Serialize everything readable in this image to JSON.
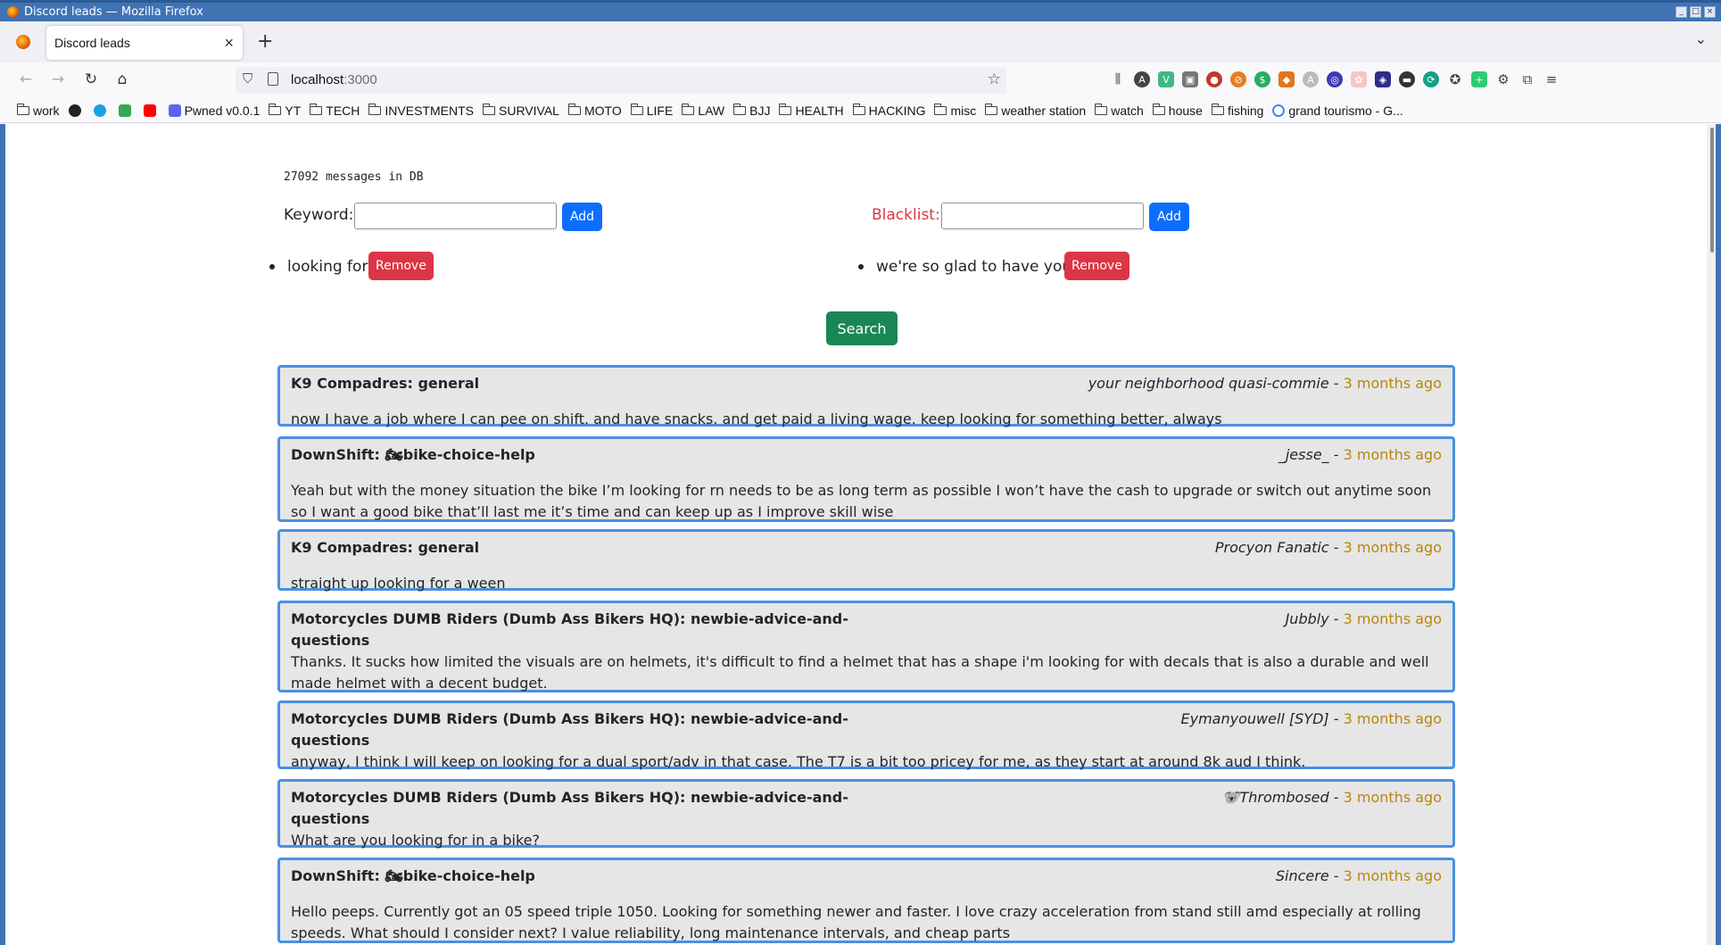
{
  "window": {
    "title": "Discord leads — Mozilla Firefox"
  },
  "tab": {
    "title": "Discord leads"
  },
  "url": {
    "host": "localhost",
    "port": ":3000"
  },
  "bookmarks": [
    {
      "label": "work",
      "kind": "folder"
    },
    {
      "label": "",
      "kind": "github"
    },
    {
      "label": "",
      "kind": "e"
    },
    {
      "label": "",
      "kind": "play"
    },
    {
      "label": "",
      "kind": "youtube"
    },
    {
      "label": "Pwned v0.0.1",
      "kind": "pwned"
    },
    {
      "label": "YT",
      "kind": "folder"
    },
    {
      "label": "TECH",
      "kind": "folder"
    },
    {
      "label": "INVESTMENTS",
      "kind": "folder"
    },
    {
      "label": "SURVIVAL",
      "kind": "folder"
    },
    {
      "label": "MOTO",
      "kind": "folder"
    },
    {
      "label": "LIFE",
      "kind": "folder"
    },
    {
      "label": "LAW",
      "kind": "folder"
    },
    {
      "label": "BJJ",
      "kind": "folder"
    },
    {
      "label": "HEALTH",
      "kind": "folder"
    },
    {
      "label": "HACKING",
      "kind": "folder"
    },
    {
      "label": "misc",
      "kind": "folder"
    },
    {
      "label": "weather station",
      "kind": "folder"
    },
    {
      "label": "watch",
      "kind": "folder"
    },
    {
      "label": "house",
      "kind": "folder"
    },
    {
      "label": "fishing",
      "kind": "folder"
    },
    {
      "label": "grand tourismo - G...",
      "kind": "google"
    }
  ],
  "page": {
    "count": "27092 messages in DB",
    "keyword": {
      "label": "Keyword:",
      "value": "",
      "add": "Add"
    },
    "blacklist": {
      "label": "Blacklist:",
      "value": "",
      "add": "Add"
    },
    "keyword_terms": [
      {
        "text": "looking for",
        "remove": "Remove"
      }
    ],
    "blacklist_terms": [
      {
        "text": "we're so glad to have you",
        "remove": "Remove"
      }
    ],
    "search": "Search",
    "results": [
      {
        "channel": "K9 Compadres: general",
        "author": "your neighborhood quasi-commie",
        "sep": " - ",
        "ago": "3 months ago",
        "text": "now I have a job where I can pee on shift. and have snacks. and get paid a living wage. keep looking for something better, always"
      },
      {
        "channel": "DownShift: 🏍bike-choice-help",
        "author": "_jesse_",
        "sep": " - ",
        "ago": "3 months ago",
        "text": "Yeah but with the money situation the bike I’m looking for rn needs to be as long term as possible I won’t have the cash to upgrade or switch out anytime soon so I want a good bike that’ll last me it’s time and can keep up as I improve skill wise"
      },
      {
        "channel": "K9 Compadres: general",
        "author": "Procyon Fanatic",
        "sep": " - ",
        "ago": "3 months ago",
        "text": "straight up looking for a ween"
      },
      {
        "channel": "Motorcycles DUMB Riders (Dumb Ass Bikers HQ): newbie-advice-and-questions",
        "author": "Jubbly",
        "sep": " - ",
        "ago": "3 months ago",
        "text": "Thanks. It sucks how limited the visuals are on helmets, it's difficult to find a helmet that has a shape i'm looking for with decals that is also a durable and well made helmet with a decent budget."
      },
      {
        "channel": "Motorcycles DUMB Riders (Dumb Ass Bikers HQ): newbie-advice-and-questions",
        "author": "Eymanyouwell [SYD]",
        "sep": " - ",
        "ago": "3 months ago",
        "text": "anyway, I think I will keep on looking for a dual sport/adv in that case. The T7 is a bit too pricey for me, as they start at around 8k aud I think."
      },
      {
        "channel": "Motorcycles DUMB Riders (Dumb Ass Bikers HQ): newbie-advice-and-questions",
        "author": "🐨Thrombosed",
        "sep": " - ",
        "ago": "3 months ago",
        "text": "What are you looking for in a bike?"
      },
      {
        "channel": "DownShift: 🏍bike-choice-help",
        "author": "Sincere",
        "sep": " - ",
        "ago": "3 months ago",
        "text": "Hello peeps. Currently got an 05 speed triple 1050. Looking for something newer and faster. I love crazy acceleration from stand still amd especially at rolling speeds. What should I consider next? I value reliability, long maintenance intervals, and cheap parts"
      }
    ]
  }
}
